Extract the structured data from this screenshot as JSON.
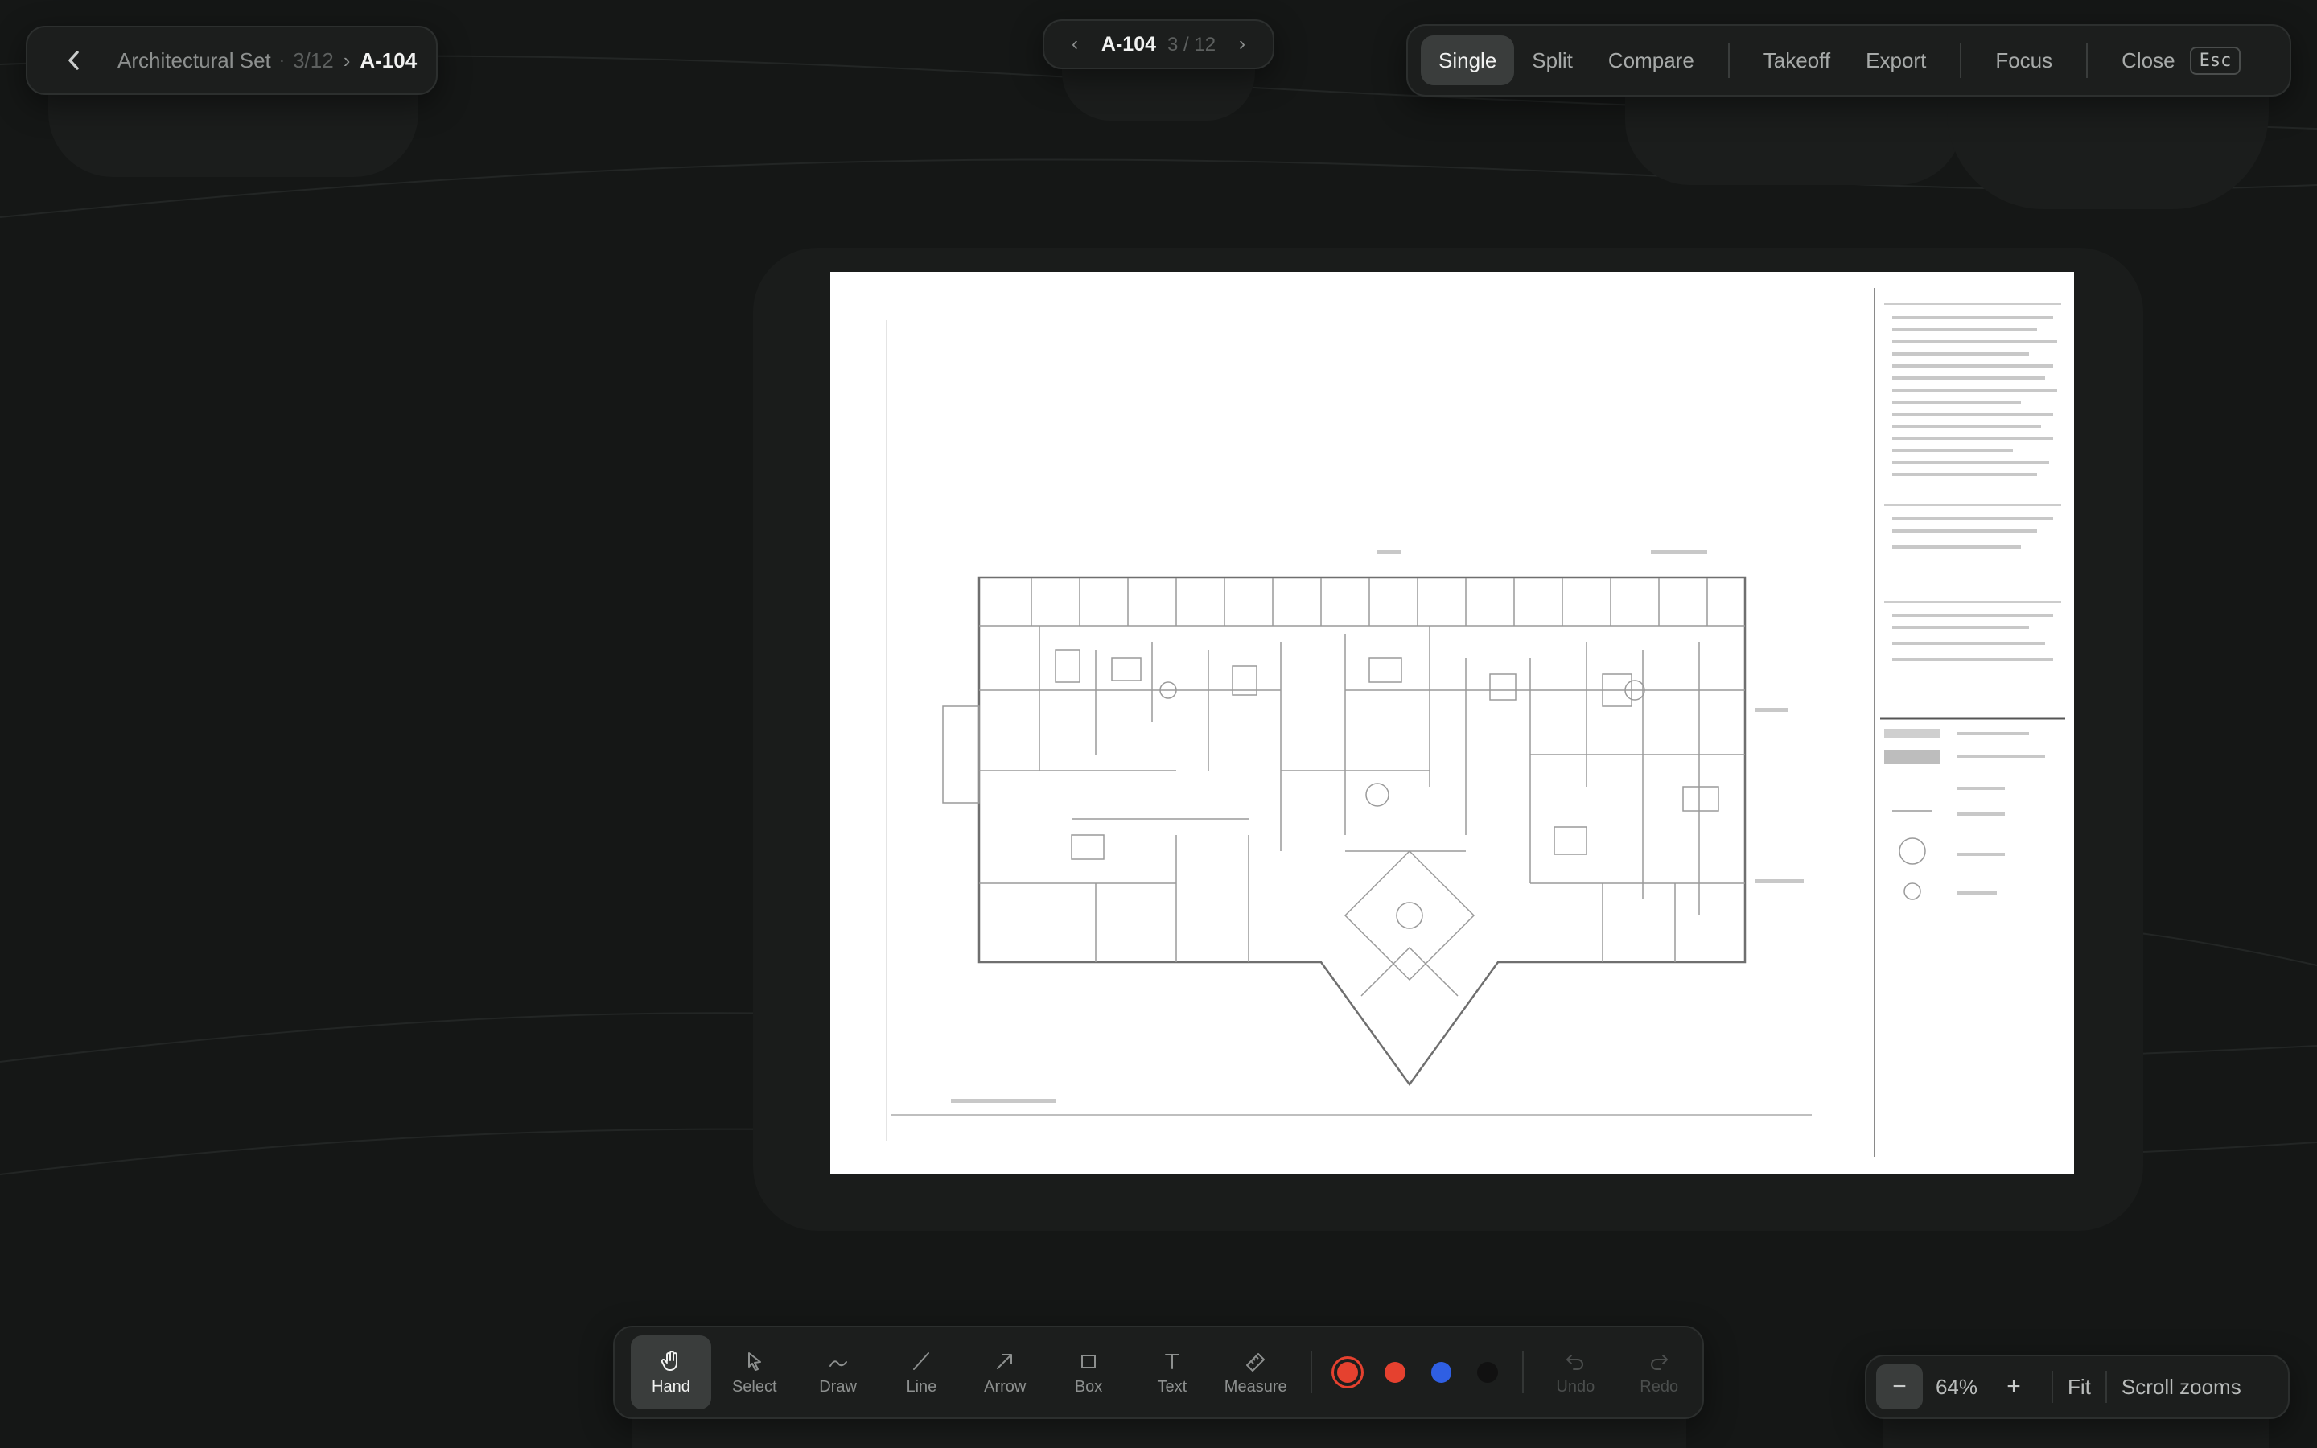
{
  "breadcrumb": {
    "set_name": "Architectural Set",
    "separator": "·",
    "position": "3/12",
    "chevron": "›",
    "sheet": "A-104"
  },
  "sheet_nav": {
    "prev": "‹",
    "sheet": "A-104",
    "count": "3 / 12",
    "next": "›"
  },
  "modes": {
    "items": [
      "Single",
      "Split",
      "Compare"
    ],
    "active": "Single",
    "takeoff": "Takeoff",
    "export": "Export",
    "focus": "Focus",
    "close": "Close",
    "close_key": "Esc"
  },
  "toolbar": {
    "tools": [
      {
        "label": "Hand",
        "icon": "hand-icon",
        "active": true
      },
      {
        "label": "Select",
        "icon": "cursor-icon"
      },
      {
        "label": "Draw",
        "icon": "pen-stroke-icon"
      },
      {
        "label": "Line",
        "icon": "line-icon"
      },
      {
        "label": "Arrow",
        "icon": "arrow-icon"
      },
      {
        "label": "Box",
        "icon": "box-icon"
      },
      {
        "label": "Text",
        "icon": "text-icon"
      },
      {
        "label": "Measure",
        "icon": "ruler-icon"
      }
    ],
    "colors": [
      "#e5412f",
      "#e5412f",
      "#2f5fe3",
      "#111111"
    ],
    "selected_color": "#e5412f",
    "undo": "Undo",
    "redo": "Redo"
  },
  "zoom": {
    "minus": "−",
    "value": "64%",
    "plus": "+",
    "fit": "Fit",
    "scroll_hint": "Scroll zooms"
  }
}
